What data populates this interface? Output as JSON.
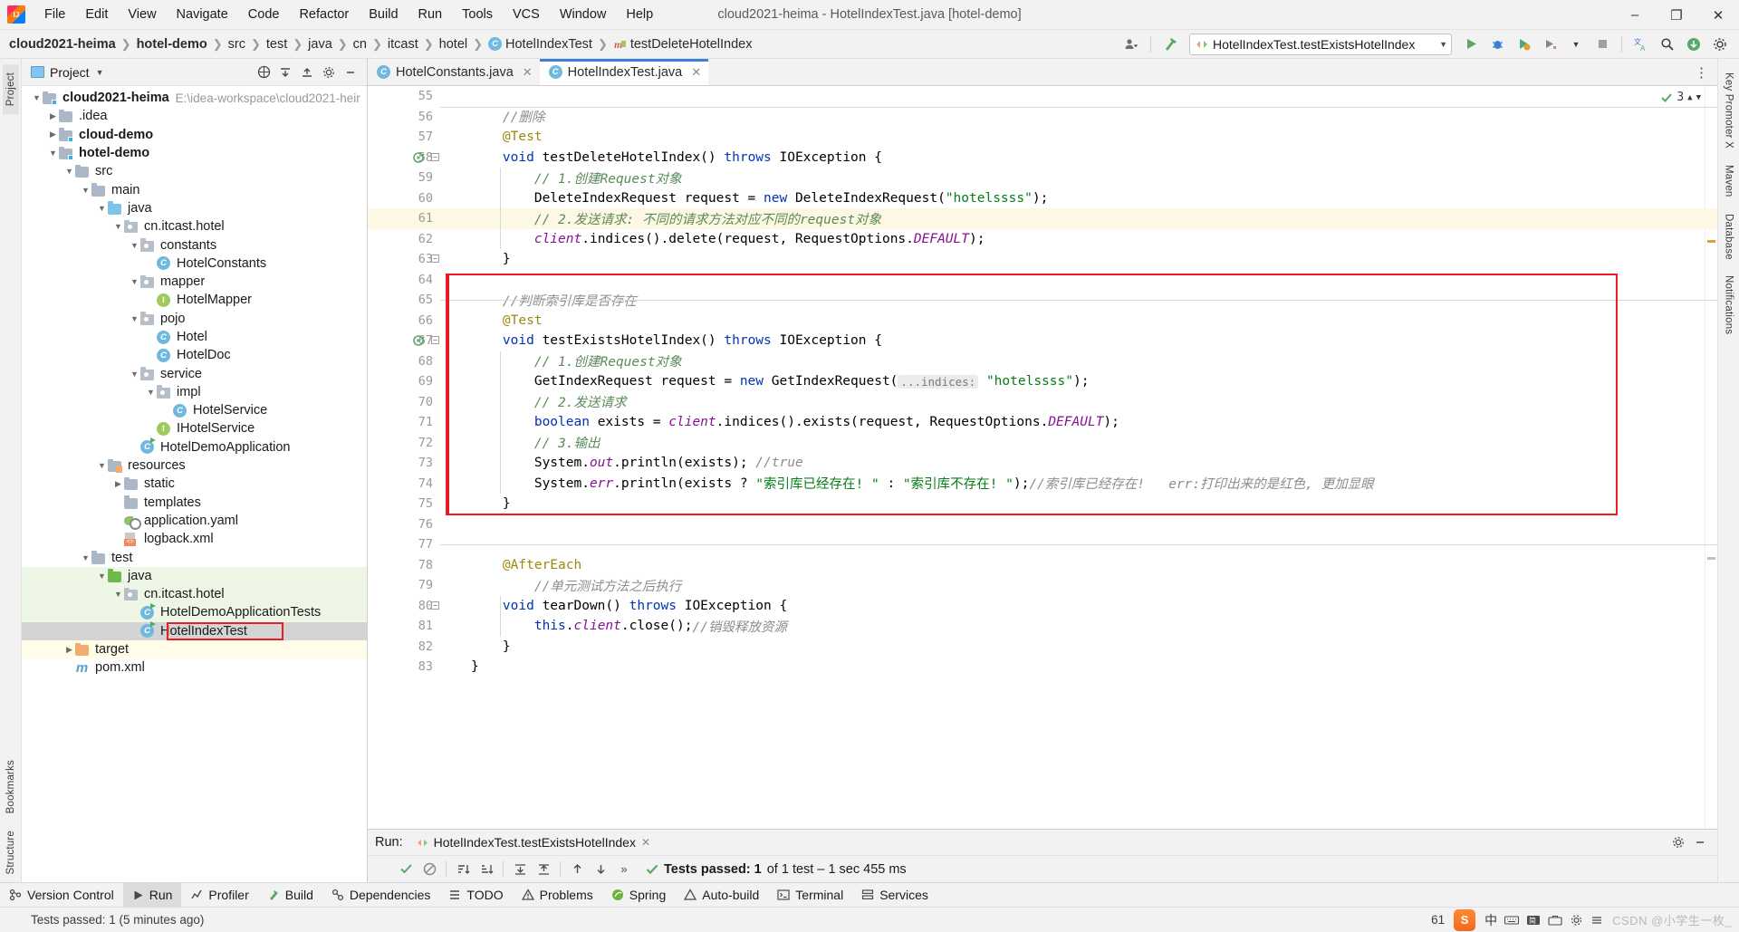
{
  "window": {
    "title": "cloud2021-heima - HotelIndexTest.java [hotel-demo]",
    "minimize": "–",
    "maximize": "❐",
    "close": "✕"
  },
  "menu": [
    "File",
    "Edit",
    "View",
    "Navigate",
    "Code",
    "Refactor",
    "Build",
    "Run",
    "Tools",
    "VCS",
    "Window",
    "Help"
  ],
  "breadcrumb": [
    {
      "label": "cloud2021-heima",
      "bold": true
    },
    {
      "label": "hotel-demo",
      "bold": true
    },
    {
      "label": "src",
      "bold": false
    },
    {
      "label": "test",
      "bold": false
    },
    {
      "label": "java",
      "bold": false
    },
    {
      "label": "cn",
      "bold": false
    },
    {
      "label": "itcast",
      "bold": false
    },
    {
      "label": "hotel",
      "bold": false
    },
    {
      "label": "HotelIndexTest",
      "bold": false,
      "icon": "class-icon"
    },
    {
      "label": "testDeleteHotelIndex",
      "bold": false,
      "icon": "method-icon"
    }
  ],
  "toolbar": {
    "run_config": "HotelIndexTest.testExistsHotelIndex",
    "run": "run-icon",
    "debug": "debug-icon",
    "coverage": "coverage-icon",
    "profile": "profile-icon",
    "stop": "stop-icon",
    "translate": "translate-icon",
    "search": "search-icon",
    "updates": "updates-icon",
    "account": "account-icon",
    "build": "hammer-icon",
    "settings": "settings-icon"
  },
  "project_panel": {
    "title": "Project",
    "header_icons": [
      "scope-icon",
      "expand-all-icon",
      "collapse-all-icon",
      "settings-icon",
      "hide-icon"
    ],
    "tree": [
      {
        "depth": 0,
        "label": "cloud2021-heima",
        "hint": "E:\\idea-workspace\\cloud2021-heir",
        "icon": "module-folder",
        "arrow": "down",
        "bold": true
      },
      {
        "depth": 1,
        "label": ".idea",
        "icon": "folder",
        "arrow": "right"
      },
      {
        "depth": 1,
        "label": "cloud-demo",
        "icon": "module-folder",
        "arrow": "right",
        "bold": true
      },
      {
        "depth": 1,
        "label": "hotel-demo",
        "icon": "module-folder",
        "arrow": "down",
        "bold": true
      },
      {
        "depth": 2,
        "label": "src",
        "icon": "folder",
        "arrow": "down"
      },
      {
        "depth": 3,
        "label": "main",
        "icon": "folder",
        "arrow": "down"
      },
      {
        "depth": 4,
        "label": "java",
        "icon": "source-folder",
        "arrow": "down"
      },
      {
        "depth": 5,
        "label": "cn.itcast.hotel",
        "icon": "package",
        "arrow": "down"
      },
      {
        "depth": 6,
        "label": "constants",
        "icon": "package",
        "arrow": "down"
      },
      {
        "depth": 7,
        "label": "HotelConstants",
        "icon": "class"
      },
      {
        "depth": 6,
        "label": "mapper",
        "icon": "package",
        "arrow": "down"
      },
      {
        "depth": 7,
        "label": "HotelMapper",
        "icon": "interface"
      },
      {
        "depth": 6,
        "label": "pojo",
        "icon": "package",
        "arrow": "down"
      },
      {
        "depth": 7,
        "label": "Hotel",
        "icon": "class"
      },
      {
        "depth": 7,
        "label": "HotelDoc",
        "icon": "class"
      },
      {
        "depth": 6,
        "label": "service",
        "icon": "package",
        "arrow": "down"
      },
      {
        "depth": 7,
        "label": "impl",
        "icon": "package",
        "arrow": "down"
      },
      {
        "depth": 8,
        "label": "HotelService",
        "icon": "class"
      },
      {
        "depth": 7,
        "label": "IHotelService",
        "icon": "interface"
      },
      {
        "depth": 6,
        "label": "HotelDemoApplication",
        "icon": "runnable-class"
      },
      {
        "depth": 4,
        "label": "resources",
        "icon": "resources-folder",
        "arrow": "down"
      },
      {
        "depth": 5,
        "label": "static",
        "icon": "folder",
        "arrow": "right"
      },
      {
        "depth": 5,
        "label": "templates",
        "icon": "folder"
      },
      {
        "depth": 5,
        "label": "application.yaml",
        "icon": "yaml"
      },
      {
        "depth": 5,
        "label": "logback.xml",
        "icon": "xml"
      },
      {
        "depth": 3,
        "label": "test",
        "icon": "folder",
        "arrow": "down"
      },
      {
        "depth": 4,
        "label": "java",
        "icon": "test-source-folder",
        "arrow": "down",
        "bg": "green"
      },
      {
        "depth": 5,
        "label": "cn.itcast.hotel",
        "icon": "package",
        "arrow": "down",
        "bg": "green"
      },
      {
        "depth": 6,
        "label": "HotelDemoApplicationTests",
        "icon": "runnable-class",
        "bg": "green"
      },
      {
        "depth": 6,
        "label": "HotelIndexTest",
        "icon": "runnable-class",
        "selected": true,
        "redbox": true
      },
      {
        "depth": 2,
        "label": "target",
        "icon": "target-folder",
        "arrow": "right",
        "bg": "yellow"
      },
      {
        "depth": 2,
        "label": "pom.xml",
        "icon": "maven"
      }
    ]
  },
  "left_rail": [
    "Project",
    "Bookmarks",
    "Structure"
  ],
  "right_rail": [
    "Key Promoter X",
    "Maven",
    "Database",
    "Notifications"
  ],
  "editor": {
    "tabs": [
      {
        "label": "HotelConstants.java",
        "icon": "class-icon",
        "active": false
      },
      {
        "label": "HotelIndexTest.java",
        "icon": "class-icon",
        "active": true
      }
    ],
    "inspection": {
      "count": "3",
      "status": "ok"
    },
    "first_line": 55,
    "lines": [
      {
        "n": 55,
        "tokens": []
      },
      {
        "n": 56,
        "tokens": [
          {
            "t": "    //删除",
            "c": "cmt"
          }
        ]
      },
      {
        "n": 57,
        "tokens": [
          {
            "t": "    @Test",
            "c": "ann"
          }
        ]
      },
      {
        "n": 58,
        "gutter_run": true,
        "fold": true,
        "tokens": [
          {
            "t": "    ",
            "c": "ident"
          },
          {
            "t": "void ",
            "c": "kw"
          },
          {
            "t": "testDeleteHotelIndex() ",
            "c": "ident"
          },
          {
            "t": "throws ",
            "c": "kw"
          },
          {
            "t": "IOException {",
            "c": "ident"
          }
        ]
      },
      {
        "n": 59,
        "tokens": [
          {
            "t": "        // 1.创建Request对象",
            "c": "cmt-green"
          }
        ]
      },
      {
        "n": 60,
        "tokens": [
          {
            "t": "        DeleteIndexRequest request = ",
            "c": "ident"
          },
          {
            "t": "new ",
            "c": "kw"
          },
          {
            "t": "DeleteIndexRequest(",
            "c": "ident"
          },
          {
            "t": "\"hotelssss\"",
            "c": "str"
          },
          {
            "t": ");",
            "c": "ident"
          }
        ]
      },
      {
        "n": 61,
        "hl": true,
        "tokens": [
          {
            "t": "        // 2.发送请求: 不同的请求方法对应不同的request对象",
            "c": "cmt-green"
          }
        ]
      },
      {
        "n": 62,
        "tokens": [
          {
            "t": "        ",
            "c": "ident"
          },
          {
            "t": "client",
            "c": "fld"
          },
          {
            "t": ".indices().delete(request, RequestOptions.",
            "c": "ident"
          },
          {
            "t": "DEFAULT",
            "c": "stat"
          },
          {
            "t": ");",
            "c": "ident"
          }
        ]
      },
      {
        "n": 63,
        "fold": true,
        "tokens": [
          {
            "t": "    }",
            "c": "ident"
          }
        ]
      },
      {
        "n": 64,
        "tokens": []
      },
      {
        "n": 65,
        "tokens": [
          {
            "t": "    //判断索引库是否存在",
            "c": "cmt"
          }
        ]
      },
      {
        "n": 66,
        "tokens": [
          {
            "t": "    @Test",
            "c": "ann"
          }
        ]
      },
      {
        "n": 67,
        "gutter_run": true,
        "fold": true,
        "tokens": [
          {
            "t": "    ",
            "c": "ident"
          },
          {
            "t": "void ",
            "c": "kw"
          },
          {
            "t": "testExistsHotelIndex() ",
            "c": "ident"
          },
          {
            "t": "throws ",
            "c": "kw"
          },
          {
            "t": "IOException {",
            "c": "ident"
          }
        ]
      },
      {
        "n": 68,
        "tokens": [
          {
            "t": "        // 1.创建Request对象",
            "c": "cmt-green"
          }
        ]
      },
      {
        "n": 69,
        "tokens": [
          {
            "t": "        GetIndexRequest request = ",
            "c": "ident"
          },
          {
            "t": "new ",
            "c": "kw"
          },
          {
            "t": "GetIndexRequest(",
            "c": "ident"
          },
          {
            "t": "...indices:",
            "c": "hint"
          },
          {
            "t": " ",
            "c": "ident"
          },
          {
            "t": "\"hotelssss\"",
            "c": "str"
          },
          {
            "t": ");",
            "c": "ident"
          }
        ]
      },
      {
        "n": 70,
        "tokens": [
          {
            "t": "        // 2.发送请求",
            "c": "cmt-green"
          }
        ]
      },
      {
        "n": 71,
        "tokens": [
          {
            "t": "        ",
            "c": "ident"
          },
          {
            "t": "boolean ",
            "c": "kw"
          },
          {
            "t": "exists = ",
            "c": "ident"
          },
          {
            "t": "client",
            "c": "fld"
          },
          {
            "t": ".indices().exists(request, RequestOptions.",
            "c": "ident"
          },
          {
            "t": "DEFAULT",
            "c": "stat"
          },
          {
            "t": ");",
            "c": "ident"
          }
        ]
      },
      {
        "n": 72,
        "tokens": [
          {
            "t": "        // 3.输出",
            "c": "cmt-green"
          }
        ]
      },
      {
        "n": 73,
        "tokens": [
          {
            "t": "        System.",
            "c": "ident"
          },
          {
            "t": "out",
            "c": "stat"
          },
          {
            "t": ".println(exists); ",
            "c": "ident"
          },
          {
            "t": "//true",
            "c": "cmt"
          }
        ]
      },
      {
        "n": 74,
        "tokens": [
          {
            "t": "        System.",
            "c": "ident"
          },
          {
            "t": "err",
            "c": "stat"
          },
          {
            "t": ".println(exists ? ",
            "c": "ident"
          },
          {
            "t": "\"索引库已经存在! \"",
            "c": "str"
          },
          {
            "t": " : ",
            "c": "ident"
          },
          {
            "t": "\"索引库不存在! \"",
            "c": "str"
          },
          {
            "t": ");",
            "c": "ident"
          },
          {
            "t": "//索引库已经存在!   err:打印出来的是红色, 更加显眼",
            "c": "cmt"
          }
        ]
      },
      {
        "n": 75,
        "tokens": [
          {
            "t": "    }",
            "c": "ident"
          }
        ]
      },
      {
        "n": 76,
        "tokens": []
      },
      {
        "n": 77,
        "tokens": []
      },
      {
        "n": 78,
        "tokens": [
          {
            "t": "    @AfterEach",
            "c": "ann"
          }
        ]
      },
      {
        "n": 79,
        "tokens": [
          {
            "t": "        //单元测试方法之后执行",
            "c": "cmt"
          }
        ]
      },
      {
        "n": 80,
        "gutter_run": false,
        "fold": true,
        "tokens": [
          {
            "t": "    ",
            "c": "ident"
          },
          {
            "t": "void ",
            "c": "kw"
          },
          {
            "t": "tearDown() ",
            "c": "ident"
          },
          {
            "t": "throws ",
            "c": "kw"
          },
          {
            "t": "IOException {",
            "c": "ident"
          }
        ]
      },
      {
        "n": 81,
        "tokens": [
          {
            "t": "        ",
            "c": "ident"
          },
          {
            "t": "this",
            "c": "kw"
          },
          {
            "t": ".",
            "c": "ident"
          },
          {
            "t": "client",
            "c": "fld"
          },
          {
            "t": ".close();",
            "c": "ident"
          },
          {
            "t": "//销毁释放资源",
            "c": "cmt"
          }
        ]
      },
      {
        "n": 82,
        "tokens": [
          {
            "t": "    }",
            "c": "ident"
          }
        ]
      },
      {
        "n": 83,
        "tokens": [
          {
            "t": "}",
            "c": "ident"
          }
        ]
      }
    ]
  },
  "run_window": {
    "label": "Run:",
    "tab": "HotelIndexTest.testExistsHotelIndex",
    "result_text": "Tests passed: 1",
    "result_detail": "of 1 test – 1 sec 455 ms",
    "toolbar_icons": [
      "rerun-icon",
      "rerun-failed-icon",
      "sort-by-duration-icon",
      "sort-alphabetically-icon",
      "expand-all-icon",
      "collapse-all-icon",
      "prev-icon",
      "next-icon",
      "more-icon"
    ],
    "header_icons": [
      "settings-icon",
      "minimize-icon"
    ]
  },
  "tool_buttons": [
    {
      "label": "Version Control",
      "icon": "vcs-icon",
      "active": false
    },
    {
      "label": "Run",
      "icon": "run-icon",
      "active": true
    },
    {
      "label": "Profiler",
      "icon": "profiler-icon",
      "active": false
    },
    {
      "label": "Build",
      "icon": "build-icon",
      "active": false
    },
    {
      "label": "Dependencies",
      "icon": "dependencies-icon",
      "active": false
    },
    {
      "label": "TODO",
      "icon": "todo-icon",
      "active": false
    },
    {
      "label": "Problems",
      "icon": "problems-icon",
      "active": false
    },
    {
      "label": "Spring",
      "icon": "spring-icon",
      "active": false
    },
    {
      "label": "Auto-build",
      "icon": "autobuild-icon",
      "active": false
    },
    {
      "label": "Terminal",
      "icon": "terminal-icon",
      "active": false
    },
    {
      "label": "Services",
      "icon": "services-icon",
      "active": false
    }
  ],
  "status_bar": {
    "message": "Tests passed: 1 (5 minutes ago)",
    "position": "61",
    "ime_lang": "中",
    "ime_items": [
      "keyboard-icon",
      "input-method-icon",
      "toolbox-icon",
      "settings-icon",
      "menu-icon"
    ],
    "watermark": "CSDN @小学生一枚_"
  }
}
